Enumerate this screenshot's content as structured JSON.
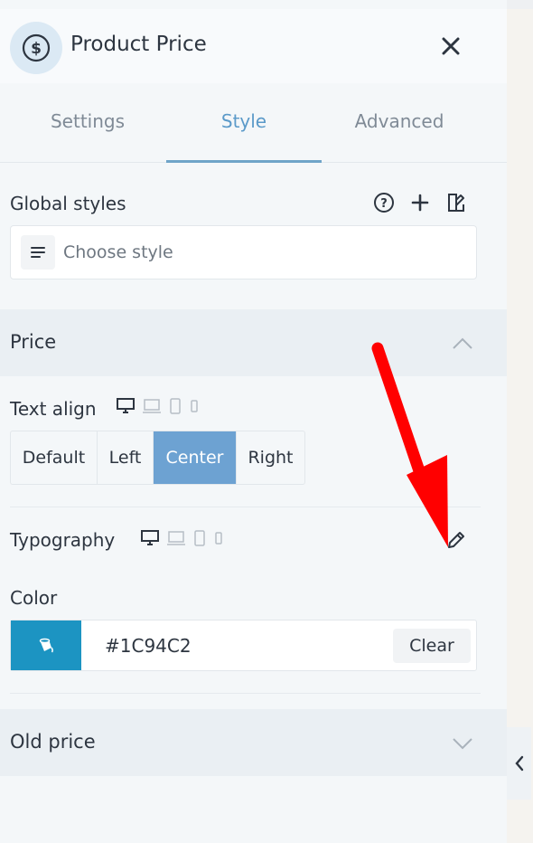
{
  "header": {
    "title": "Product Price",
    "icon": "dollar-circle-icon",
    "close_icon": "close-icon"
  },
  "tabs": [
    {
      "label": "Settings",
      "active": false
    },
    {
      "label": "Style",
      "active": true
    },
    {
      "label": "Advanced",
      "active": false
    }
  ],
  "global_styles": {
    "label": "Global styles",
    "icons": [
      "help-icon",
      "plus-icon",
      "edit-style-icon"
    ],
    "select_placeholder": "Choose style"
  },
  "price_section": {
    "label": "Price",
    "expanded": true,
    "text_align": {
      "label": "Text align",
      "options": [
        "Default",
        "Left",
        "Center",
        "Right"
      ],
      "selected": "Center"
    },
    "typography": {
      "label": "Typography"
    },
    "color": {
      "label": "Color",
      "value": "#1C94C2",
      "swatch": "#1c94c2",
      "clear_label": "Clear"
    }
  },
  "old_price_section": {
    "label": "Old price",
    "expanded": false
  },
  "colors": {
    "accent": "#6da2d2",
    "tab_active": "#5b9ac9",
    "arrow": "#ff0000"
  }
}
